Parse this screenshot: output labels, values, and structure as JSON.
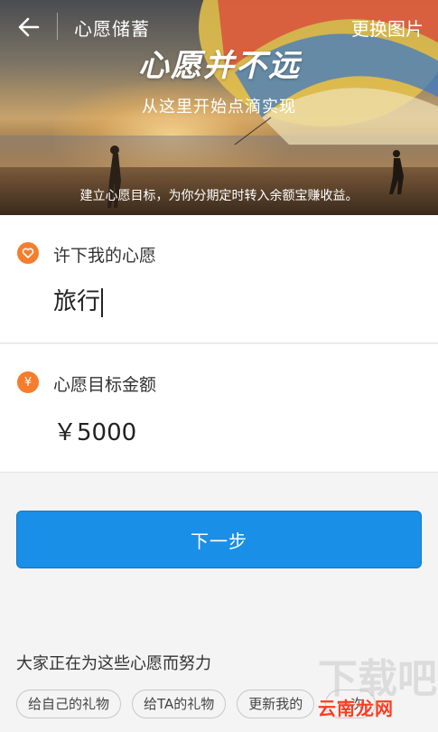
{
  "header": {
    "title": "心愿储蓄",
    "change_image_label": "更换图片"
  },
  "hero": {
    "slogan": "心愿并不远",
    "subtitle": "从这里开始点滴实现",
    "note": "建立心愿目标，为你分期定时转入余额宝赚收益。"
  },
  "wish": {
    "icon": "heart-icon",
    "label": "许下我的心愿",
    "value": "旅行"
  },
  "amount": {
    "icon": "yen-icon",
    "label": "心愿目标金额",
    "value": "￥5000"
  },
  "next_button": "下一步",
  "suggestions": {
    "title": "大家正在为这些心愿而努力",
    "chips": [
      "给自己的礼物",
      "给TA的礼物",
      "更新我的",
      "一次"
    ]
  },
  "watermark": {
    "text": "云南龙网",
    "big": "下载吧"
  },
  "colors": {
    "accent_orange": "#f57d2c",
    "primary_blue": "#1a8fe8"
  }
}
